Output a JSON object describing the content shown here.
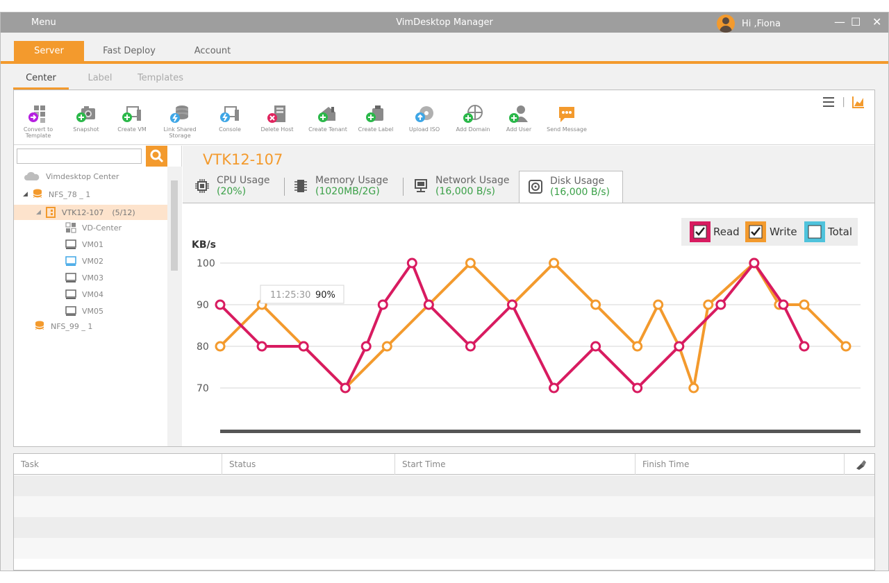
{
  "titlebar": {
    "menu": "Menu",
    "title": "VimDesktop Manager",
    "greeting": "Hi ,Fiona",
    "minimize": "—",
    "maximize": "☐",
    "close": "✕"
  },
  "main_tabs": [
    {
      "label": "Server",
      "active": true
    },
    {
      "label": "Fast Deploy",
      "active": false
    },
    {
      "label": "Account",
      "active": false
    }
  ],
  "sub_tabs": [
    {
      "label": "Center",
      "active": true
    },
    {
      "label": "Label",
      "active": false
    },
    {
      "label": "Templates",
      "active": false
    }
  ],
  "toolbar": [
    {
      "label": "Convert to Template",
      "icon": "convert-template-icon"
    },
    {
      "label": "Snapshot",
      "icon": "snapshot-icon"
    },
    {
      "label": "Create VM",
      "icon": "create-vm-icon"
    },
    {
      "label": "Link Shared Storage",
      "icon": "link-storage-icon"
    },
    {
      "label": "Console",
      "icon": "console-icon"
    },
    {
      "label": "Delete Host",
      "icon": "delete-host-icon"
    },
    {
      "label": "Create Tenant",
      "icon": "create-tenant-icon"
    },
    {
      "label": "Create Label",
      "icon": "create-label-icon"
    },
    {
      "label": "Upload ISO",
      "icon": "upload-iso-icon"
    },
    {
      "label": "Add Domain",
      "icon": "add-domain-icon"
    },
    {
      "label": "Add User",
      "icon": "add-user-icon"
    },
    {
      "label": "Send Message",
      "icon": "send-message-icon"
    }
  ],
  "search": {
    "value": "",
    "placeholder": ""
  },
  "tree": [
    {
      "label": "Vimdesktop Center",
      "icon": "cloud-icon"
    },
    {
      "label": "NFS_78 _ 1",
      "icon": "database-icon",
      "expanded": true
    },
    {
      "label": "VTK12-107",
      "count": "(5/12)",
      "icon": "host-icon",
      "selected": true,
      "expanded": true
    },
    {
      "label": "VD-Center",
      "icon": "grid-icon"
    },
    {
      "label": "VM01",
      "icon": "vm-icon"
    },
    {
      "label": "VM02",
      "icon": "vm-icon",
      "highlight": true
    },
    {
      "label": "VM03",
      "icon": "vm-icon"
    },
    {
      "label": "VM04",
      "icon": "vm-icon"
    },
    {
      "label": "VM05",
      "icon": "vm-icon"
    },
    {
      "label": "NFS_99 _ 1",
      "icon": "database-icon"
    }
  ],
  "vm_title": "VTK12-107",
  "usage_tabs": [
    {
      "label": "CPU Usage",
      "value": "(20%)",
      "icon": "cpu-icon",
      "active": false
    },
    {
      "label": "Memory Usage",
      "value": "(1020MB/2G)",
      "icon": "memory-icon",
      "active": false
    },
    {
      "label": "Network Usage",
      "value": "(16,000 B/s)",
      "icon": "network-icon",
      "active": false
    },
    {
      "label": "Disk Usage",
      "value": "(16,000 B/s)",
      "icon": "disk-icon",
      "active": true
    }
  ],
  "legend": [
    {
      "label": "Read",
      "checked": true,
      "color": "#d81b60"
    },
    {
      "label": "Write",
      "checked": true,
      "color": "#f39a2d"
    },
    {
      "label": "Total",
      "checked": false,
      "color": "#4fc3dc"
    }
  ],
  "tooltip": {
    "time": "11:25:30",
    "value": "90%"
  },
  "chart_data": {
    "type": "line",
    "ylabel": "KB/s",
    "yticks": [
      100,
      90,
      80,
      70
    ],
    "ylim": [
      65,
      104
    ],
    "grid": true,
    "series": [
      {
        "name": "Read",
        "color": "#d81b60",
        "x": [
          0,
          1,
          2,
          3,
          3.5,
          3.9,
          4.6,
          5,
          6,
          7,
          8,
          9,
          10,
          11,
          12,
          12.8,
          13.5,
          14
        ],
        "values": [
          90,
          80,
          80,
          70,
          80,
          90,
          100,
          90,
          80,
          90,
          70,
          80,
          70,
          80,
          90,
          100,
          90,
          80
        ]
      },
      {
        "name": "Write",
        "color": "#f39a2d",
        "x": [
          0,
          1,
          2,
          3,
          4,
          5,
          6,
          7,
          8,
          9,
          10,
          10.5,
          11,
          11.35,
          11.7,
          12.8,
          13.4,
          14,
          15
        ],
        "values": [
          80,
          90,
          80,
          70,
          80,
          90,
          100,
          90,
          100,
          90,
          80,
          90,
          80,
          70,
          90,
          100,
          90,
          90,
          80
        ]
      }
    ]
  },
  "task_table": {
    "columns": [
      "Task",
      "Status",
      "Start Time",
      "Finish Time"
    ],
    "rows": []
  },
  "colors": {
    "accent": "#f39a2d",
    "read": "#d81b60",
    "write": "#f39a2d",
    "total": "#4fc3dc",
    "value_green": "#3aa047"
  }
}
